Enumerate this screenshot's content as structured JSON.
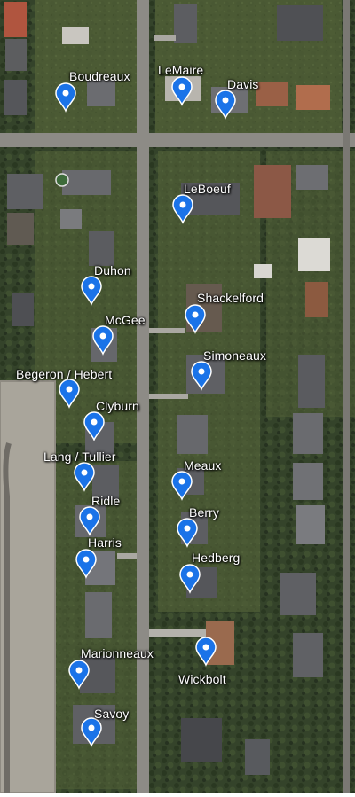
{
  "map": {
    "colors": {
      "marker_fill": "#1a73e8",
      "marker_stroke": "#ffffff",
      "label_text": "#ffffff",
      "road": "#8d8b86",
      "vegetation": "#3b4a2c"
    },
    "markers": [
      {
        "name": "Boudreaux"
      },
      {
        "name": "LeMaire"
      },
      {
        "name": "Davis"
      },
      {
        "name": "LeBoeuf"
      },
      {
        "name": "Duhon"
      },
      {
        "name": "Shackelford"
      },
      {
        "name": "McGee"
      },
      {
        "name": "Simoneaux"
      },
      {
        "name": "Begeron / Hebert"
      },
      {
        "name": "Clyburn"
      },
      {
        "name": "Lang / Tullier"
      },
      {
        "name": "Meaux"
      },
      {
        "name": "Ridle"
      },
      {
        "name": "Berry"
      },
      {
        "name": "Harris"
      },
      {
        "name": "Hedberg"
      },
      {
        "name": "Marionneaux"
      },
      {
        "name": "Wickbolt"
      },
      {
        "name": "Savoy"
      }
    ]
  }
}
